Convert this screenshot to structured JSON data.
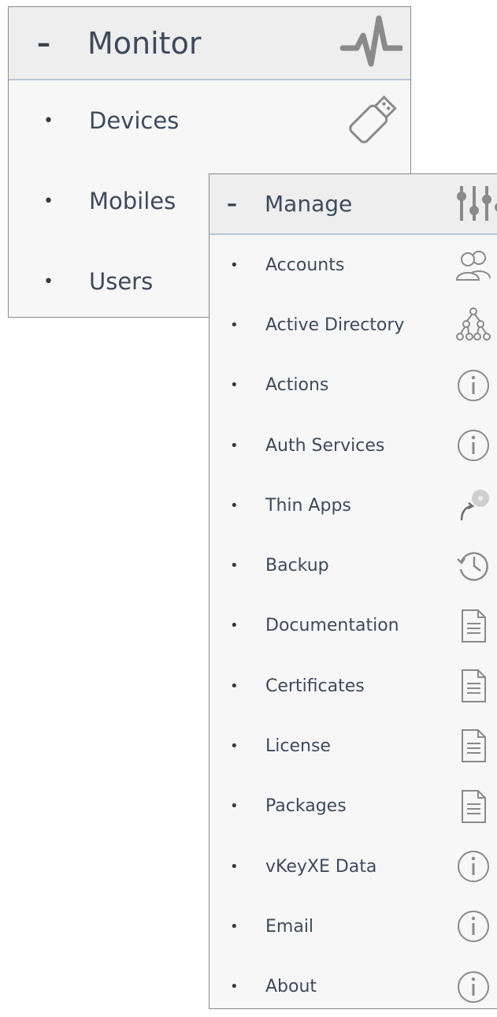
{
  "monitor": {
    "toggle": "–",
    "title": "Monitor",
    "items": [
      {
        "label": "Devices",
        "icon": "usb-drive-icon"
      },
      {
        "label": "Mobiles",
        "icon": ""
      },
      {
        "label": "Users",
        "icon": ""
      }
    ]
  },
  "manage": {
    "toggle": "–",
    "title": "Manage",
    "items": [
      {
        "label": "Accounts",
        "icon": "users-icon"
      },
      {
        "label": "Active Directory",
        "icon": "hierarchy-icon"
      },
      {
        "label": "Actions",
        "icon": "info-icon"
      },
      {
        "label": "Auth Services",
        "icon": "info-icon"
      },
      {
        "label": "Thin Apps",
        "icon": "disc-arrow-icon"
      },
      {
        "label": "Backup",
        "icon": "history-icon"
      },
      {
        "label": "Documentation",
        "icon": "document-icon"
      },
      {
        "label": "Certificates",
        "icon": "document-icon"
      },
      {
        "label": "License",
        "icon": "document-icon"
      },
      {
        "label": "Packages",
        "icon": "document-icon"
      },
      {
        "label": "vKeyXE Data",
        "icon": "info-icon"
      },
      {
        "label": "Email",
        "icon": "info-icon"
      },
      {
        "label": "About",
        "icon": "info-icon"
      }
    ]
  },
  "colors": {
    "text": "#3d4a5c",
    "header_bg": "#eeeeee",
    "panel_bg": "#f7f7f7",
    "divider": "#b4c6d8",
    "icon": "#8a8a8a"
  }
}
